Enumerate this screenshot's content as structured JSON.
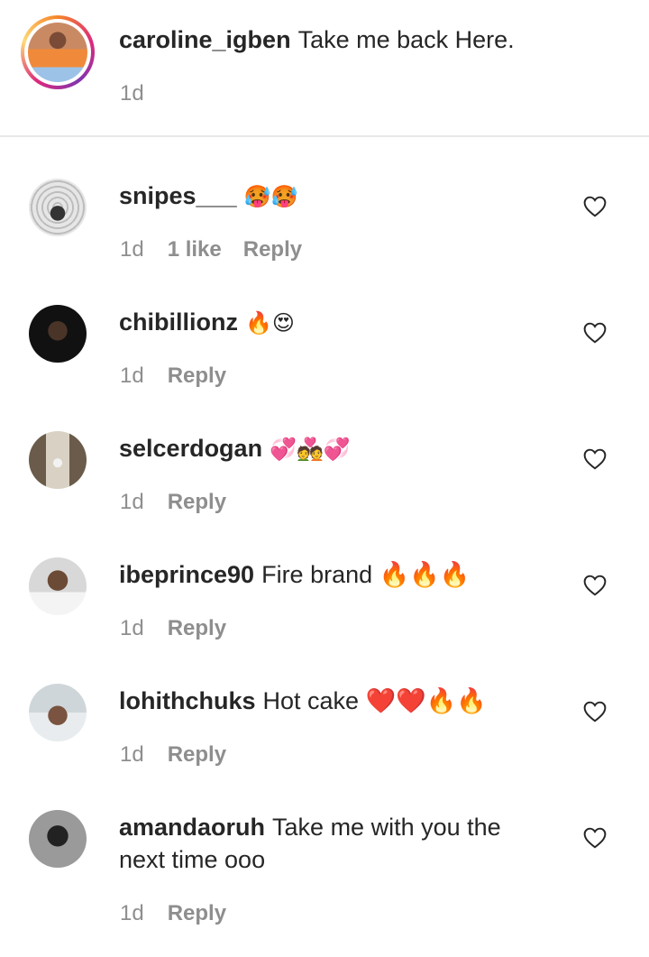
{
  "caption": {
    "username": "caroline_igben",
    "text": "Take me back Here.",
    "time": "1d"
  },
  "comments": [
    {
      "username": "snipes___",
      "text": "🥵🥵",
      "time": "1d",
      "likes": "1 like",
      "reply": "Reply"
    },
    {
      "username": "chibillionz",
      "text": "🔥😍",
      "time": "1d",
      "reply": "Reply"
    },
    {
      "username": "selcerdogan",
      "text": "💞💑💞",
      "time": "1d",
      "reply": "Reply"
    },
    {
      "username": "ibeprince90",
      "text": "Fire brand 🔥🔥🔥",
      "time": "1d",
      "reply": "Reply"
    },
    {
      "username": "lohithchuks",
      "text": "Hot cake ❤️❤️🔥🔥",
      "time": "1d",
      "reply": "Reply"
    },
    {
      "username": "amandaoruh",
      "text": "Take me with you the",
      "text_line2": "next time ooo",
      "time": "1d",
      "reply": "Reply"
    }
  ],
  "icons": {
    "like": "heart-outline-icon"
  }
}
